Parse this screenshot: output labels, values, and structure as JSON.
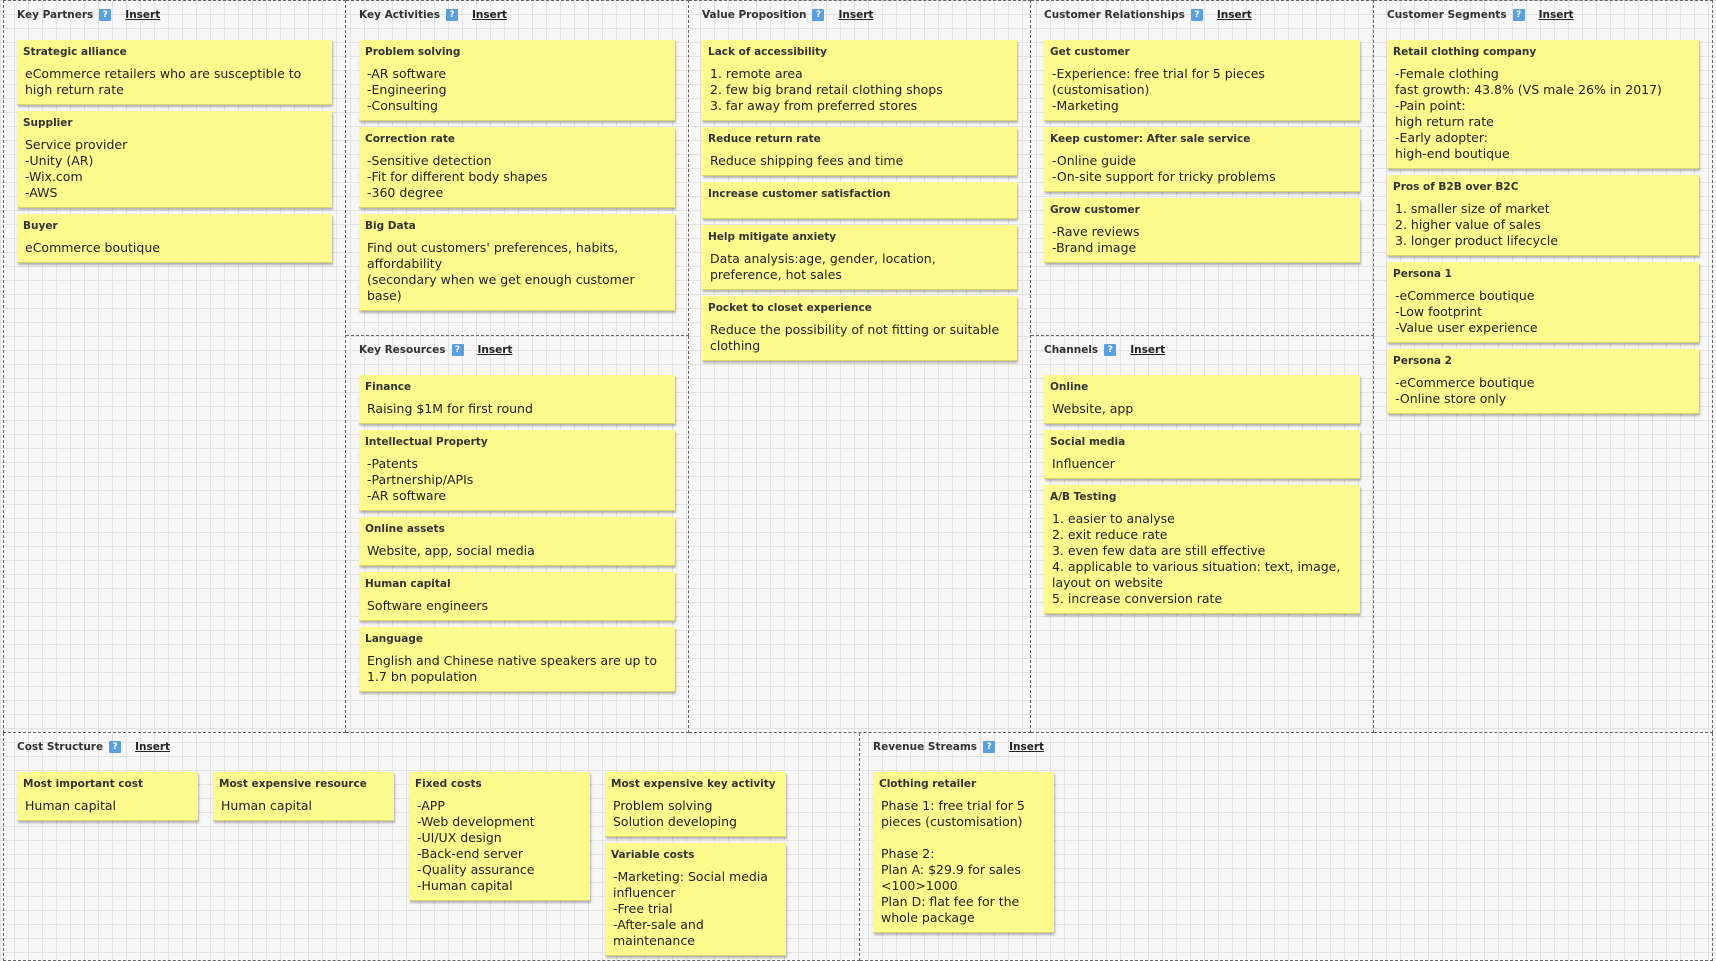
{
  "insert_label": "Insert",
  "help_label": "?",
  "sections": {
    "key_partners": {
      "title": "Key Partners",
      "notes": [
        {
          "title": "Strategic alliance",
          "body": "eCommerce retailers who are susceptible to high return rate"
        },
        {
          "title": "Supplier",
          "body": "Service provider\n-Unity (AR)\n-Wix.com\n-AWS"
        },
        {
          "title": "Buyer",
          "body": "eCommerce boutique"
        }
      ]
    },
    "key_activities": {
      "title": "Key Activities",
      "notes": [
        {
          "title": "Problem solving",
          "body": "-AR software\n-Engineering\n-Consulting"
        },
        {
          "title": "Correction rate",
          "body": "-Sensitive detection\n-Fit for different body shapes\n-360 degree"
        },
        {
          "title": "Big Data",
          "body": "Find out customers' preferences, habits, affordability\n(secondary when we get enough customer base)"
        }
      ]
    },
    "key_resources": {
      "title": "Key Resources",
      "notes": [
        {
          "title": "Finance",
          "body": "Raising $1M for first round"
        },
        {
          "title": "Intellectual Property",
          "body": "-Patents\n-Partnership/APIs\n-AR software"
        },
        {
          "title": "Online assets",
          "body": "Website, app, social media"
        },
        {
          "title": "Human capital",
          "body": "Software engineers"
        },
        {
          "title": "Language",
          "body": "English and Chinese native speakers are up to 1.7 bn population"
        }
      ]
    },
    "value_proposition": {
      "title": "Value Proposition",
      "notes": [
        {
          "title": "Lack of accessibility",
          "body": "1. remote area\n2. few big brand retail clothing shops\n3. far away from preferred stores"
        },
        {
          "title": "Reduce return rate",
          "body": "Reduce shipping fees and time"
        },
        {
          "title": "Increase customer satisfaction",
          "body": ""
        },
        {
          "title": "Help mitigate anxiety",
          "body": "Data analysis:age, gender, location, preference, hot sales"
        },
        {
          "title": "Pocket to closet experience",
          "body": "Reduce the possibility of not fitting or suitable clothing"
        }
      ]
    },
    "customer_relationships": {
      "title": "Customer Relationships",
      "notes": [
        {
          "title": "Get customer",
          "body": "-Experience: free trial for 5 pieces (customisation)\n-Marketing"
        },
        {
          "title": "Keep customer: After sale service",
          "body": "-Online guide\n-On-site support for tricky problems"
        },
        {
          "title": "Grow customer",
          "body": "-Rave reviews\n-Brand image"
        }
      ]
    },
    "channels": {
      "title": "Channels",
      "notes": [
        {
          "title": "Online",
          "body": "Website, app"
        },
        {
          "title": "Social media",
          "body": "Influencer"
        },
        {
          "title": "A/B Testing",
          "body": "1. easier to analyse\n2. exit reduce rate\n3. even few data are still effective\n4. applicable to various situation: text, image, layout on website\n5. increase conversion rate"
        }
      ]
    },
    "customer_segments": {
      "title": "Customer Segments",
      "notes": [
        {
          "title": "Retail clothing company",
          "body": "-Female clothing\nfast growth: 43.8% (VS male 26% in 2017)\n-Pain point:\nhigh return rate\n-Early adopter:\nhigh-end boutique"
        },
        {
          "title": "Pros of B2B over B2C",
          "body": "1. smaller size of market\n2. higher value of sales\n3. longer product lifecycle"
        },
        {
          "title": "Persona 1",
          "body": "-eCommerce boutique\n-Low footprint\n-Value user experience"
        },
        {
          "title": "Persona 2",
          "body": "-eCommerce boutique\n-Online store only"
        }
      ]
    },
    "cost_structure": {
      "title": "Cost Structure",
      "columns": [
        [
          {
            "title": "Most important cost",
            "body": "Human capital"
          }
        ],
        [
          {
            "title": "Most expensive resource",
            "body": "Human capital"
          }
        ],
        [
          {
            "title": "Fixed costs",
            "body": "-APP\n-Web development\n-UI/UX design\n-Back-end server\n-Quality assurance\n-Human capital"
          }
        ],
        [
          {
            "title": "Most expensive key activity",
            "body": "Problem solving\nSolution developing"
          },
          {
            "title": "Variable costs",
            "body": "-Marketing: Social media influencer\n-Free trial\n-After-sale and maintenance"
          }
        ]
      ]
    },
    "revenue_streams": {
      "title": "Revenue Streams",
      "columns": [
        [
          {
            "title": "Clothing retailer",
            "body": "Phase 1: free trial for 5 pieces (customisation)\n\nPhase 2:\nPlan A: $29.9 for sales <100>1000\nPlan D: flat fee for the whole package"
          }
        ]
      ]
    }
  }
}
